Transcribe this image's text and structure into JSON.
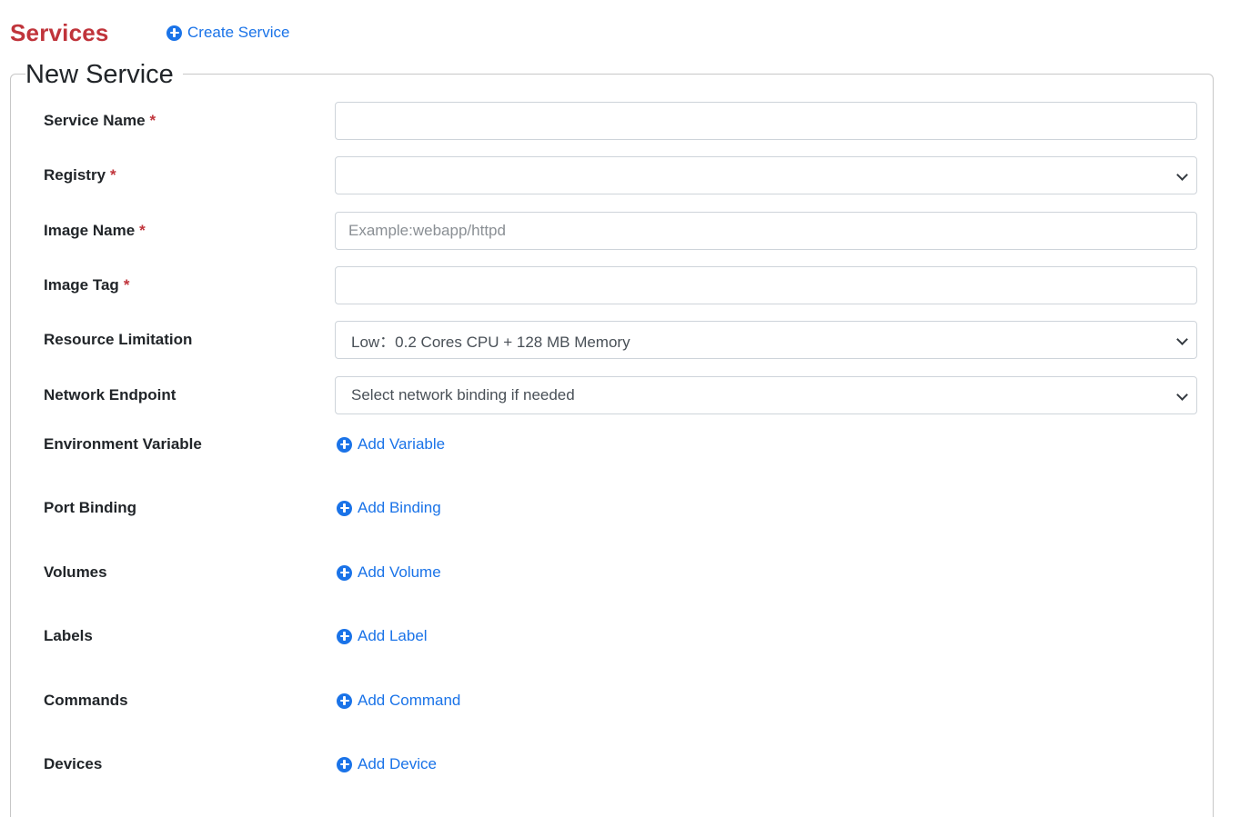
{
  "header": {
    "title": "Services",
    "create_label": "Create Service"
  },
  "form": {
    "legend": "New Service",
    "required_mark": "*",
    "fields": {
      "service_name": {
        "label": "Service Name",
        "value": "",
        "placeholder": ""
      },
      "registry": {
        "label": "Registry",
        "selected": ""
      },
      "image_name": {
        "label": "Image Name",
        "value": "",
        "placeholder": "Example:webapp/httpd"
      },
      "image_tag": {
        "label": "Image Tag",
        "value": "",
        "placeholder": ""
      },
      "resource_limitation": {
        "label": "Resource Limitation",
        "selected": "Low：0.2 Cores CPU + 128 MB Memory"
      },
      "network_endpoint": {
        "label": "Network Endpoint",
        "selected": "Select network binding if needed"
      }
    },
    "adders": {
      "environment_variable": {
        "label": "Environment Variable",
        "action": "Add Variable"
      },
      "port_binding": {
        "label": "Port Binding",
        "action": "Add Binding"
      },
      "volumes": {
        "label": "Volumes",
        "action": "Add Volume"
      },
      "labels": {
        "label": "Labels",
        "action": "Add Label"
      },
      "commands": {
        "label": "Commands",
        "action": "Add Command"
      },
      "devices": {
        "label": "Devices",
        "action": "Add Device"
      }
    }
  },
  "colors": {
    "title": "#c0343b",
    "link": "#1a73e8",
    "required": "#c0343b"
  }
}
